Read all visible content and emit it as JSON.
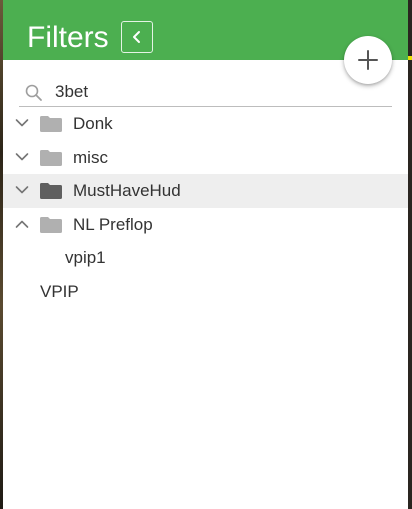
{
  "header": {
    "title": "Filters",
    "collapse_icon": "chevron-left-icon",
    "add_icon": "plus-icon",
    "color": "#4caf50"
  },
  "search": {
    "icon": "search-icon",
    "value": "3bet"
  },
  "tree": {
    "items": [
      {
        "label": "Donk",
        "type": "folder",
        "expanded": false
      },
      {
        "label": "misc",
        "type": "folder",
        "expanded": false
      },
      {
        "label": "MustHaveHud",
        "type": "folder",
        "expanded": false,
        "selected": true
      },
      {
        "label": "NL Preflop",
        "type": "folder",
        "expanded": true
      },
      {
        "label": "vpip1",
        "type": "filter",
        "parent": "NL Preflop"
      },
      {
        "label": "VPIP",
        "type": "filter"
      }
    ]
  }
}
